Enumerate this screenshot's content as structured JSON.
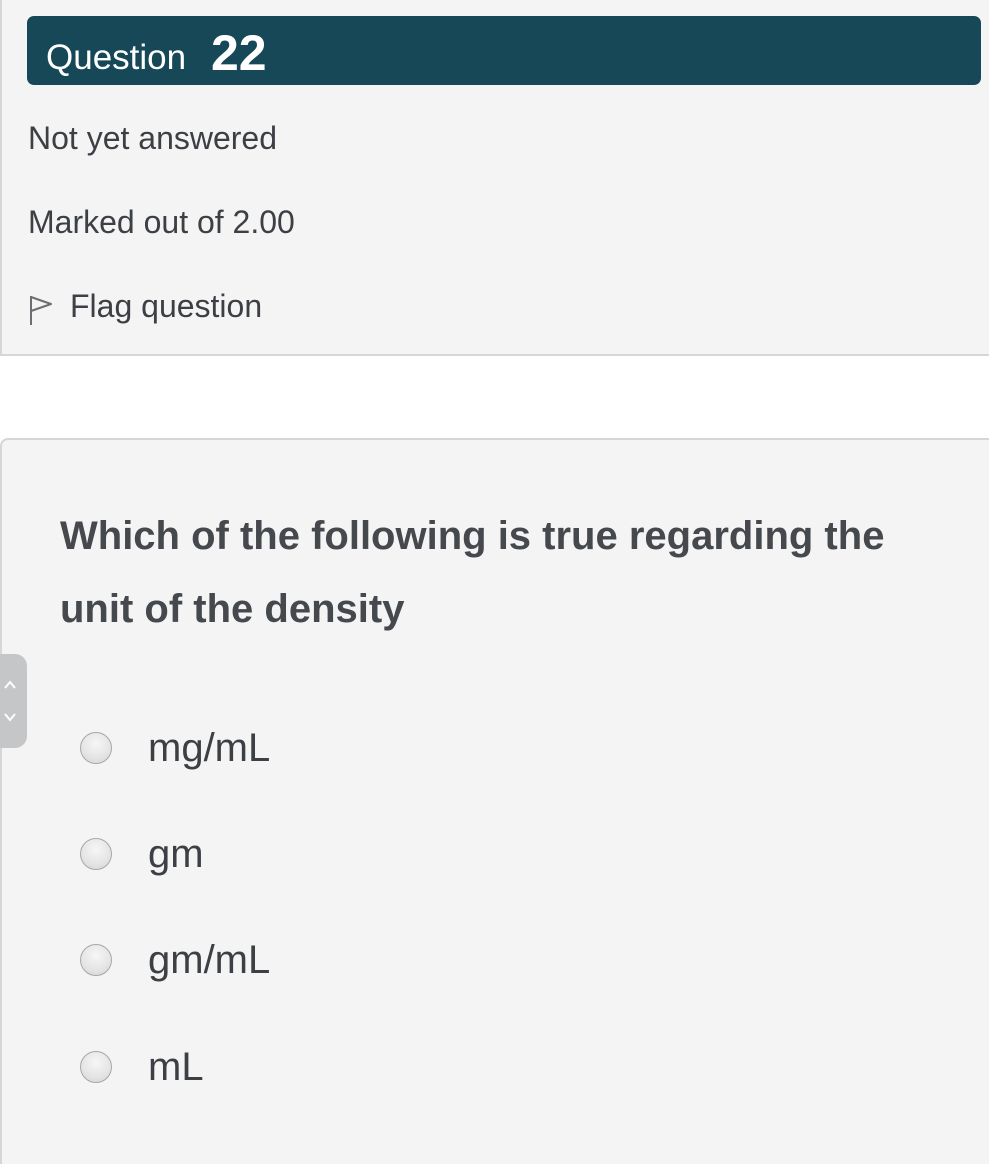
{
  "info": {
    "question_word": "Question",
    "question_number": "22",
    "state": "Not yet answered",
    "grade": "Marked out of 2.00",
    "flag_label": "Flag question"
  },
  "question": {
    "text": "Which of the following is true regarding the unit of the density",
    "options": [
      {
        "label": "mg/mL",
        "selected": false
      },
      {
        "label": "gm",
        "selected": false
      },
      {
        "label": "gm/mL",
        "selected": false
      },
      {
        "label": "mL",
        "selected": false
      }
    ]
  },
  "icons": {
    "flag": "flag-outline-icon",
    "nav_up": "chevron-up-icon",
    "nav_down": "chevron-down-icon"
  },
  "colors": {
    "header_bg": "#164858",
    "panel_bg": "#f4f4f4",
    "text": "#3c3f44"
  }
}
